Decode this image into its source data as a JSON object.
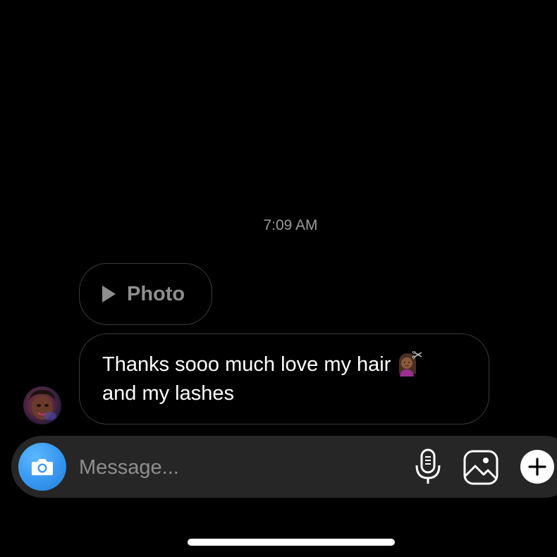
{
  "thread": {
    "timestamp": "7:09 AM",
    "messages": [
      {
        "type": "media",
        "label": "Photo",
        "icon": "play-icon"
      },
      {
        "type": "text",
        "line1": "Thanks sooo much love my hair",
        "line2": "and my lashes",
        "emoji": "woman-getting-haircut-medium-dark-skin-tone"
      }
    ]
  },
  "composer": {
    "placeholder": "Message...",
    "icons": [
      "camera-icon",
      "microphone-icon",
      "gallery-icon",
      "plus-icon"
    ],
    "accent": "#3797f0"
  },
  "colors": {
    "background": "#000000",
    "bubble_border": "#3a3a3a",
    "composer_bg": "#262626",
    "secondary_text": "#8e8e8e"
  }
}
